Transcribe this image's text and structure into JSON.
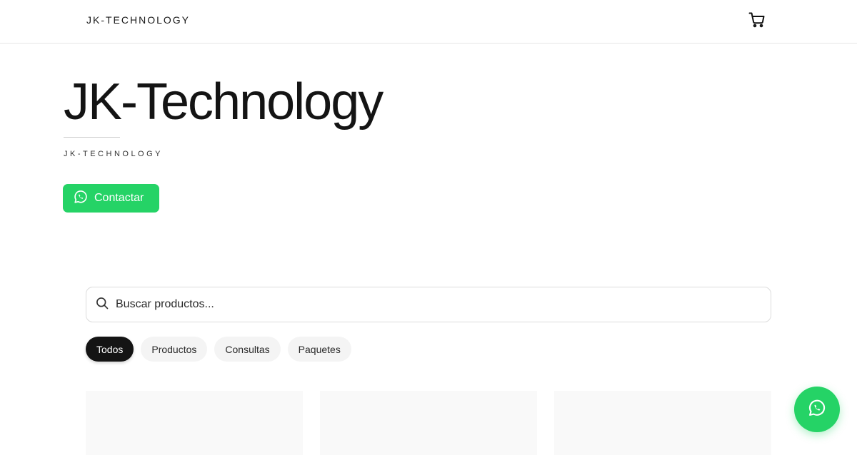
{
  "header": {
    "brand": "JK-TECHNOLOGY",
    "cart_icon": "shopping-cart-icon"
  },
  "hero": {
    "title": "JK-Technology",
    "subtitle": "JK-TECHNOLOGY",
    "contact_label": "Contactar",
    "contact_icon": "whatsapp-icon"
  },
  "search": {
    "placeholder": "Buscar productos...",
    "icon": "search-icon"
  },
  "filters": [
    {
      "label": "Todos",
      "active": true
    },
    {
      "label": "Productos",
      "active": false
    },
    {
      "label": "Consultas",
      "active": false
    },
    {
      "label": "Paquetes",
      "active": false
    }
  ],
  "floating_button": {
    "icon": "whatsapp-icon"
  },
  "colors": {
    "accent": "#25d366",
    "active_chip": "#141414",
    "chip_bg": "#f4f4f4",
    "card_bg": "#f9f9f9"
  }
}
